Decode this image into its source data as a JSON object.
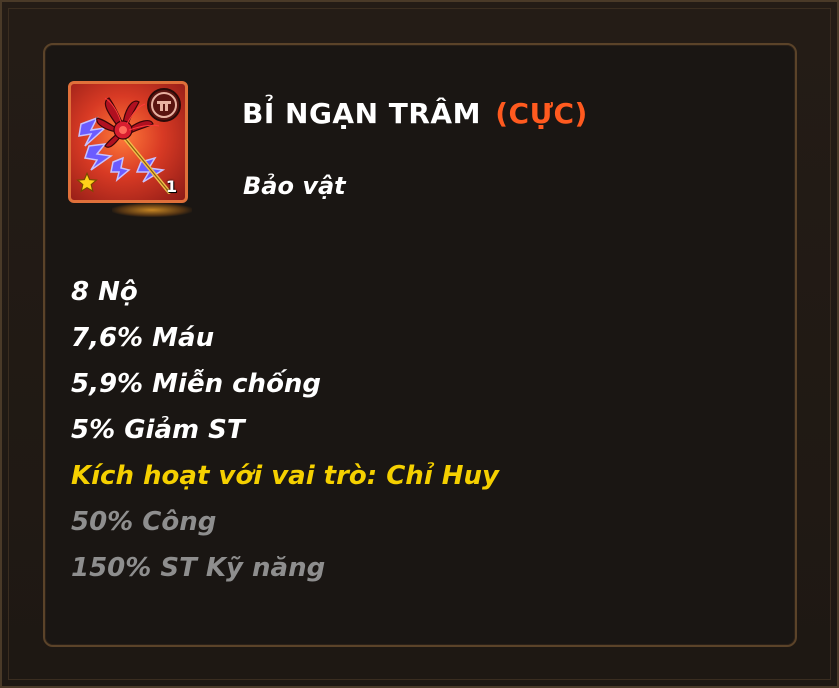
{
  "item": {
    "name": "BỈ NGẠN TRÂM",
    "rarity": "(CỰC)",
    "type": "Bảo vật",
    "icon": "red-spider-lily-hairpin-icon",
    "role_icon": "commander-role-icon",
    "star_icon": "star-icon",
    "level": "1"
  },
  "stats": [
    {
      "text": "8 Nộ",
      "state": "active"
    },
    {
      "text": "7,6% Máu",
      "state": "active"
    },
    {
      "text": "5,9% Miễn chống",
      "state": "active"
    },
    {
      "text": "5% Giảm ST",
      "state": "active"
    },
    {
      "text": "Kích hoạt với vai trò: Chỉ Huy",
      "state": "condition"
    },
    {
      "text": "50% Công",
      "state": "inactive"
    },
    {
      "text": "150% ST Kỹ năng",
      "state": "inactive"
    }
  ],
  "colors": {
    "rarity": "#ff5a1f",
    "active": "#ffffff",
    "condition": "#f5d000",
    "inactive": "#8e8e8e",
    "panel_border": "#5b4329"
  }
}
